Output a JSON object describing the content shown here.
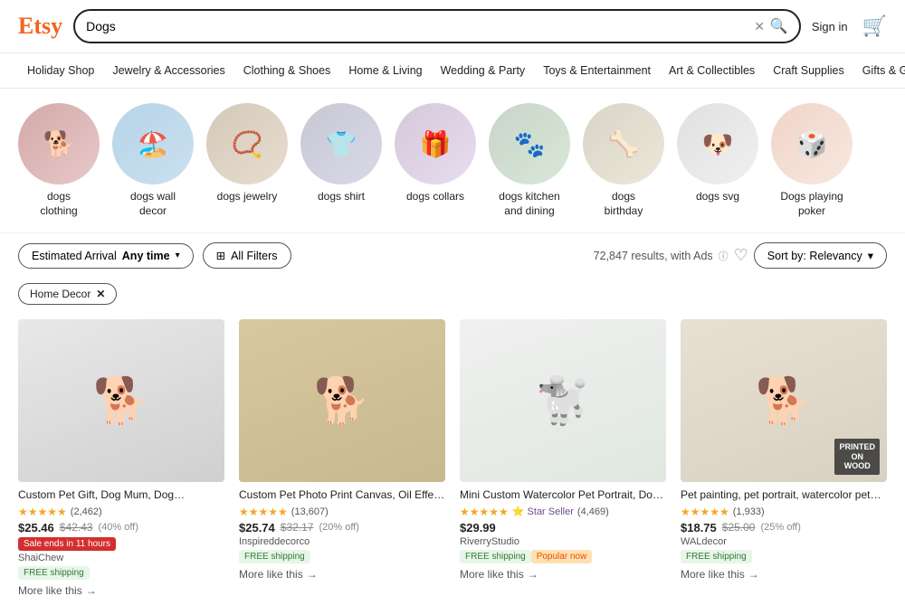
{
  "header": {
    "logo": "Etsy",
    "search_value": "Dogs",
    "sign_in_label": "Sign in",
    "cart_title": "Cart"
  },
  "nav": {
    "items": [
      "Holiday Shop",
      "Jewelry & Accessories",
      "Clothing & Shoes",
      "Home & Living",
      "Wedding & Party",
      "Toys & Entertainment",
      "Art & Collectibles",
      "Craft Supplies",
      "Gifts & Gift Cards"
    ]
  },
  "categories": [
    {
      "id": 1,
      "label": "dogs\nclothing",
      "emoji": "🐕",
      "bg": "cat-1"
    },
    {
      "id": 2,
      "label": "dogs wall\ndecor",
      "emoji": "🏖️",
      "bg": "cat-2"
    },
    {
      "id": 3,
      "label": "dogs jewelry",
      "emoji": "📿",
      "bg": "cat-3"
    },
    {
      "id": 4,
      "label": "dogs shirt",
      "emoji": "👕",
      "bg": "cat-4"
    },
    {
      "id": 5,
      "label": "dogs collars",
      "emoji": "🎁",
      "bg": "cat-5"
    },
    {
      "id": 6,
      "label": "dogs kitchen\nand dining",
      "emoji": "🐾",
      "bg": "cat-6"
    },
    {
      "id": 7,
      "label": "dogs\nbirthday",
      "emoji": "🦴",
      "bg": "cat-7"
    },
    {
      "id": 8,
      "label": "dogs svg",
      "emoji": "🐶",
      "bg": "cat-8"
    },
    {
      "id": 9,
      "label": "Dogs playing\npoker",
      "emoji": "🎲",
      "bg": "cat-9"
    }
  ],
  "filters": {
    "arrival_label": "Estimated Arrival",
    "arrival_value": "Any time",
    "all_filters_label": "All Filters",
    "results_text": "72,847 results, with Ads",
    "sort_label": "Sort by: Relevancy",
    "active_tag": "Home Decor"
  },
  "products": [
    {
      "title": "Custom Pet Gift, Dog Mum, Dog Sympathy, Cu...",
      "stars": "★★★★★",
      "reviews": "(2,462)",
      "price": "$25.46",
      "original_price": "$42.43",
      "discount": "(40% off)",
      "sale_badge": "Sale ends in 11 hours",
      "seller": "ShaiChew",
      "free_shipping": true,
      "popular_badge": false,
      "star_seller": false,
      "more_like": "More like this",
      "emoji": "🐕",
      "bg": "product-img-1",
      "badge": null
    },
    {
      "title": "Custom Pet Photo Print Canvas, Oil Effect on C...",
      "stars": "★★★★★",
      "reviews": "(13,607)",
      "price": "$25.74",
      "original_price": "$32.17",
      "discount": "(20% off)",
      "sale_badge": null,
      "seller": "Inspireddecorco",
      "free_shipping": true,
      "popular_badge": false,
      "star_seller": false,
      "more_like": "More like this",
      "emoji": "🐕",
      "bg": "product-img-2",
      "badge": null
    },
    {
      "title": "Mini Custom Watercolor Pet Portrait, Dog Portr...",
      "stars": "★★★★★",
      "reviews": "(4,469)",
      "price": "$29.99",
      "original_price": null,
      "discount": null,
      "sale_badge": null,
      "seller": "RiverryStudio",
      "free_shipping": true,
      "popular_badge": true,
      "star_seller": true,
      "more_like": "More like this",
      "emoji": "🐩",
      "bg": "product-img-3",
      "badge": null
    },
    {
      "title": "Pet painting, pet portrait, watercolor pet painti...",
      "stars": "★★★★★",
      "reviews": "(1,933)",
      "price": "$18.75",
      "original_price": "$25.00",
      "discount": "(25% off)",
      "sale_badge": null,
      "seller": "WALdecor",
      "free_shipping": true,
      "popular_badge": false,
      "star_seller": false,
      "more_like": "More like this",
      "emoji": "🐕",
      "bg": "product-img-4",
      "badge": "PRINTED\nON\nWOOD"
    }
  ]
}
